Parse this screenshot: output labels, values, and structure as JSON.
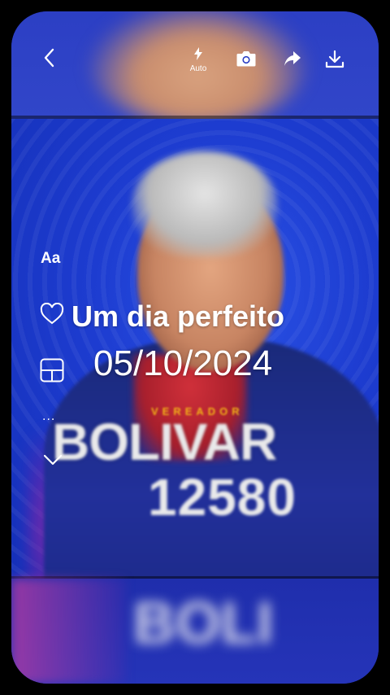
{
  "toolbar": {
    "flash_label": "Auto",
    "icons": [
      "back-icon",
      "flash-icon",
      "camera-icon",
      "share-icon",
      "download-icon"
    ]
  },
  "side_tools": {
    "text_tool_label": "Aa",
    "more_label": "...",
    "icons": [
      "heart-icon",
      "layout-icon",
      "more-icon",
      "chevron-down-icon"
    ]
  },
  "overlay": {
    "title": "Um dia perfeito",
    "date": "05/10/2024"
  },
  "poster": {
    "subtitle": "VEREADOR",
    "name": "BOLIVAR",
    "number": "12580"
  },
  "colors": {
    "poster_blue": "#1d3cd0",
    "accent_yellow": "#f2b418",
    "text_white": "#ffffff"
  }
}
